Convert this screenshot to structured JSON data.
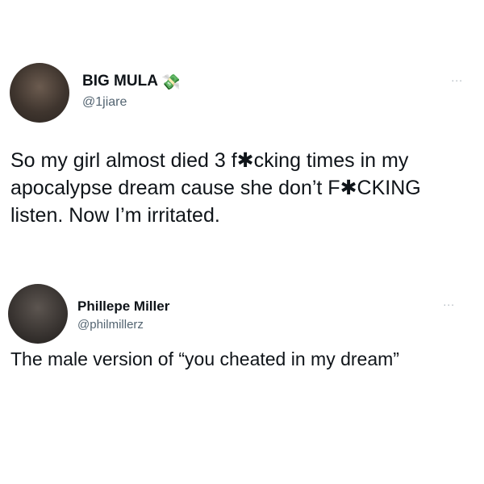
{
  "tweets": [
    {
      "display_name": "BIG MULA",
      "badge_emoji": "💸",
      "handle": "@1jiare",
      "more_label": "...",
      "text": "So my girl almost died 3 f✱cking times in my apocalypse dream cause she don’t F✱CKING listen. Now I’m irritated."
    },
    {
      "display_name": "Phillepe Miller",
      "handle": "@philmillerz",
      "more_label": "...",
      "text": "The male version of “you cheated in my dream”"
    }
  ]
}
